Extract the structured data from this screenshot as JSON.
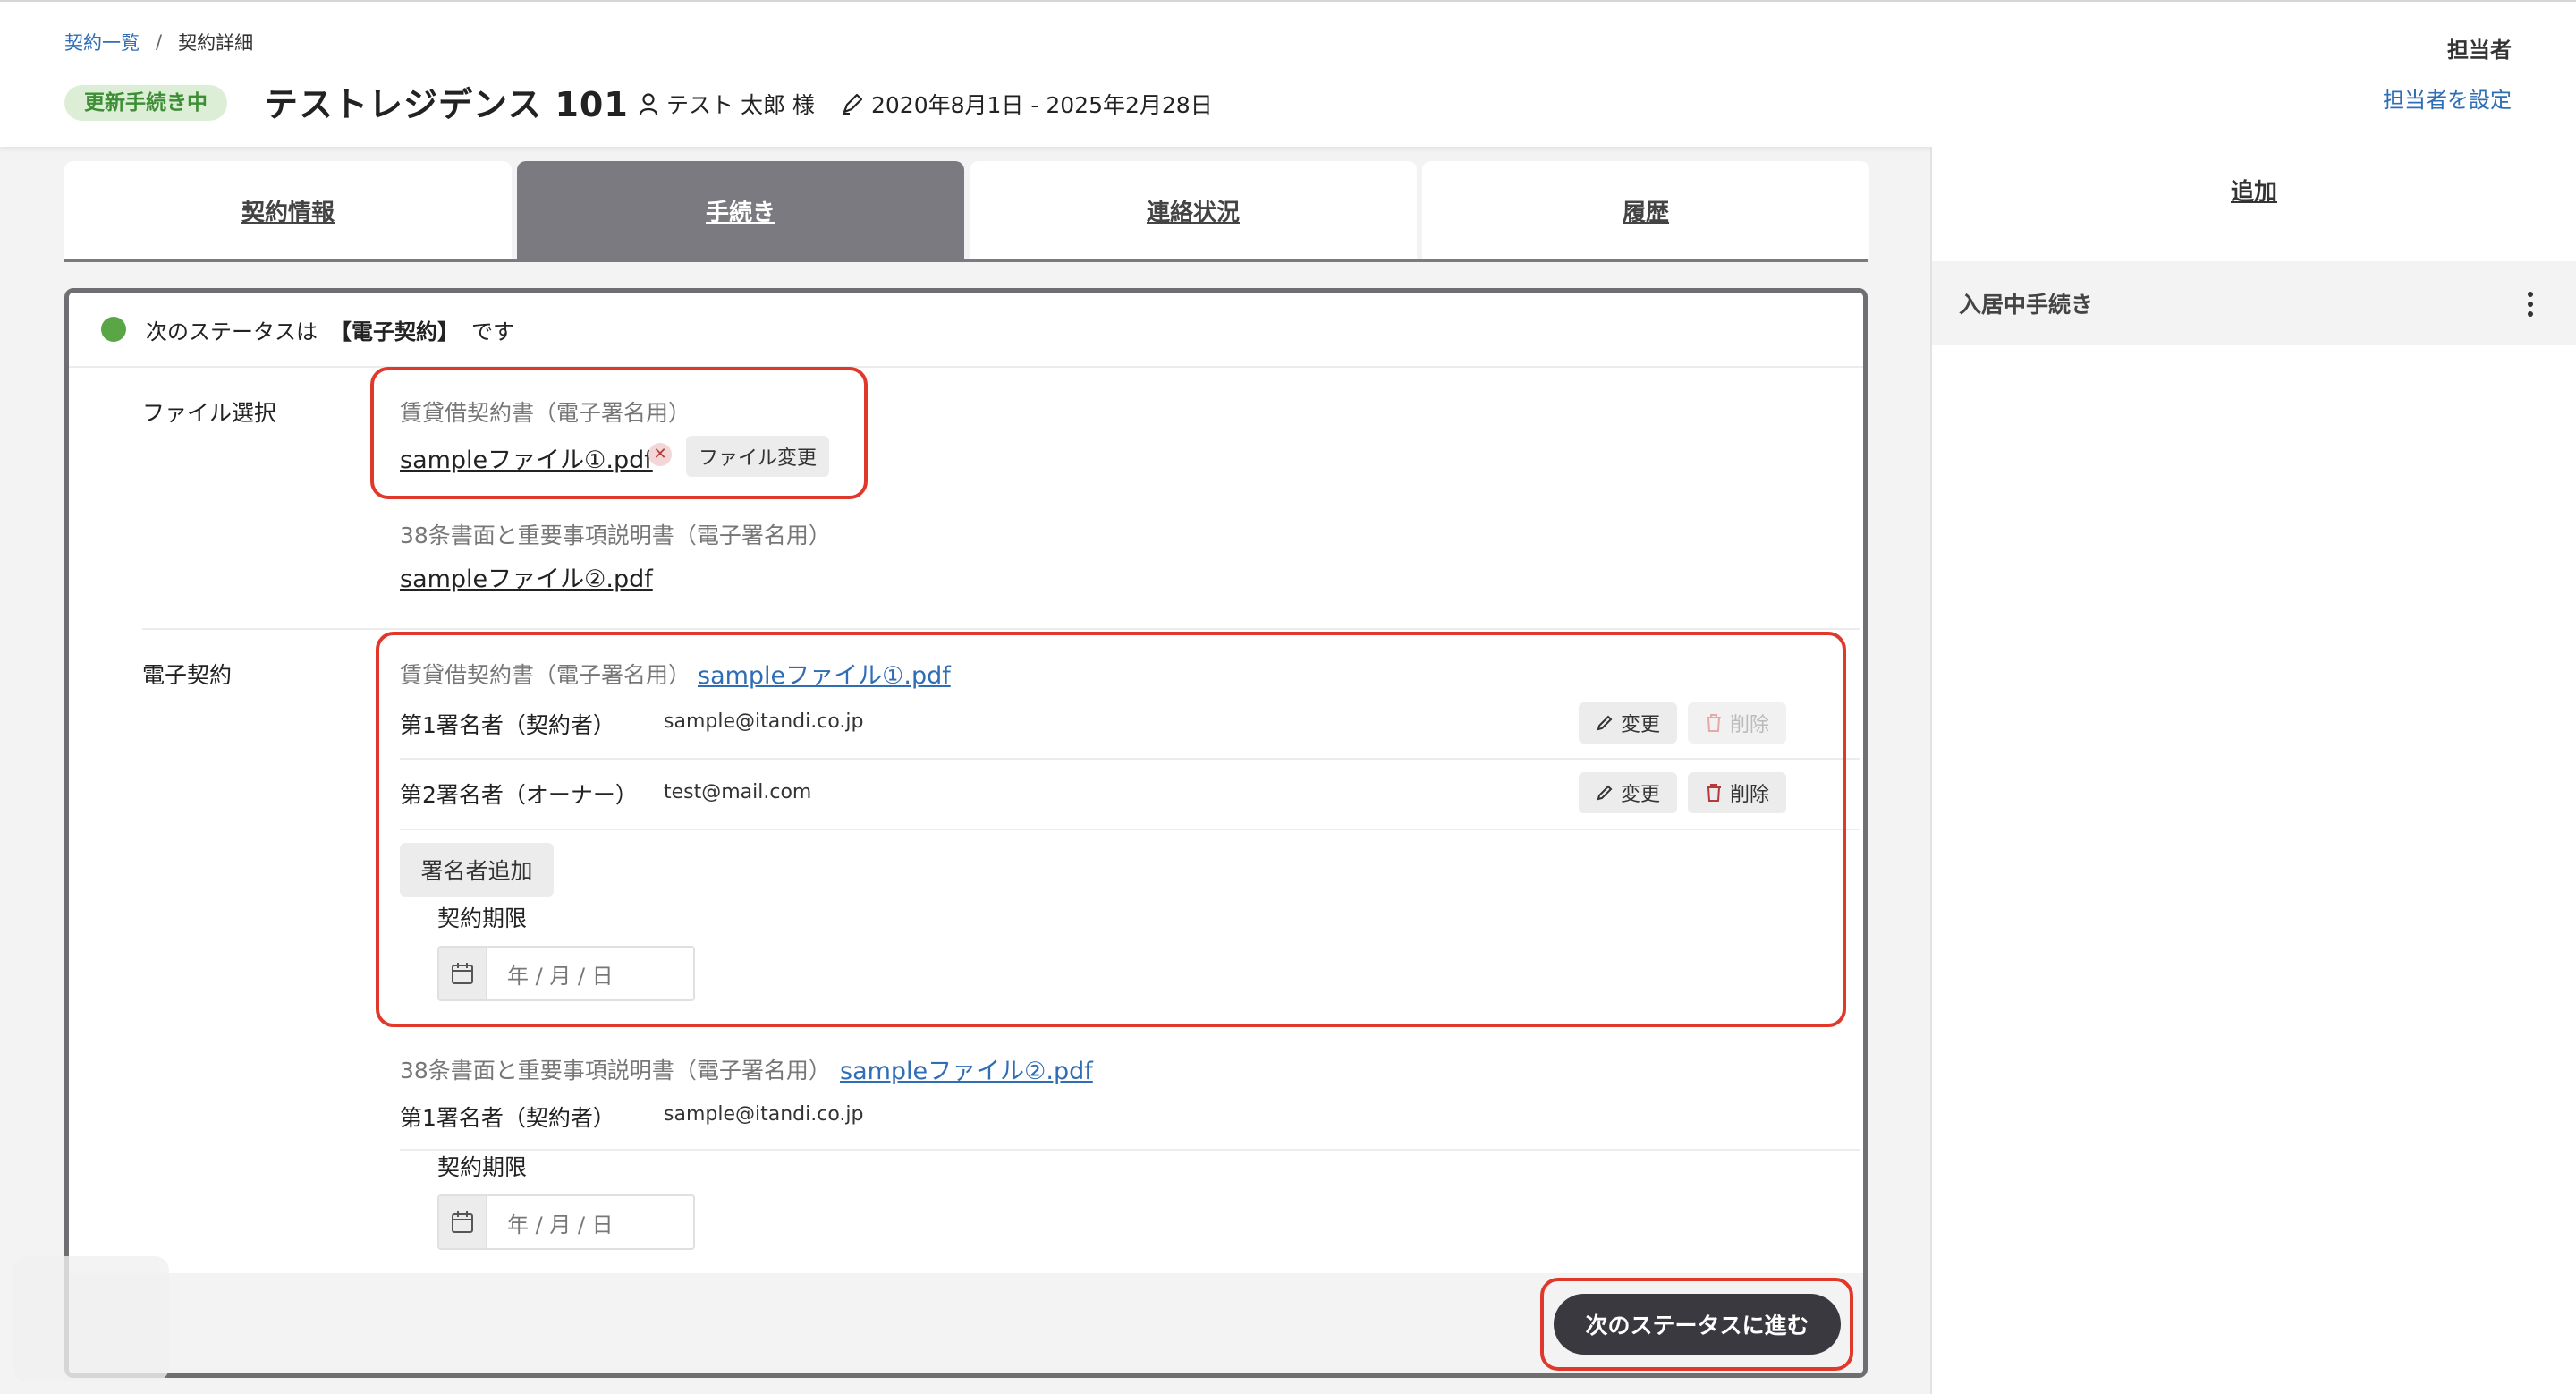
{
  "breadcrumb": {
    "root": "契約一覧",
    "separator": "/",
    "current": "契約詳細"
  },
  "header": {
    "status_badge": "更新手続き中",
    "title": "テストレジデンス 101",
    "tenant": "テスト 太郎 様",
    "period": "2020年8月1日 - 2025年2月28日",
    "assignee_label": "担当者",
    "assignee_link": "担当者を設定"
  },
  "tabs": [
    {
      "label": "契約情報",
      "active": false
    },
    {
      "label": "手続き",
      "active": true
    },
    {
      "label": "連絡状況",
      "active": false
    },
    {
      "label": "履歴",
      "active": false
    }
  ],
  "status_line": {
    "prefix": "次のステータスは",
    "status": "【電子契約】",
    "suffix": "です"
  },
  "file_select": {
    "label": "ファイル選択",
    "docs": [
      {
        "title": "賃貸借契約書（電子署名用）",
        "file": "sampleファイル①.pdf",
        "change_label": "ファイル変更"
      },
      {
        "title": "38条書面と重要事項説明書（電子署名用）",
        "file": "sampleファイル②.pdf"
      }
    ]
  },
  "e_contract": {
    "label": "電子契約",
    "docs": [
      {
        "title": "賃貸借契約書（電子署名用）",
        "file": "sampleファイル①.pdf",
        "signers": [
          {
            "role": "第1署名者（契約者）",
            "email": "sample@itandi.co.jp",
            "edit": "変更",
            "delete": "削除"
          },
          {
            "role": "第2署名者（オーナー）",
            "email": "test@mail.com",
            "edit": "変更",
            "delete": "削除"
          }
        ],
        "add_signer": "署名者追加",
        "deadline_label": "契約期限",
        "date_placeholder": "年 / 月 / 日"
      },
      {
        "title": "38条書面と重要事項説明書（電子署名用）",
        "file": "sampleファイル②.pdf",
        "signers": [
          {
            "role": "第1署名者（契約者）",
            "email": "sample@itandi.co.jp"
          }
        ],
        "deadline_label": "契約期限",
        "date_placeholder": "年 / 月 / 日"
      }
    ]
  },
  "next_button": "次のステータスに進む",
  "side": {
    "add_label": "追加",
    "item": "入居中手続き"
  },
  "colors": {
    "accent": "#2f6db5",
    "tab_active": "#7b7a80",
    "status_dot": "#5aa646",
    "highlight": "#e0392b",
    "primary_button": "#3a393f"
  }
}
